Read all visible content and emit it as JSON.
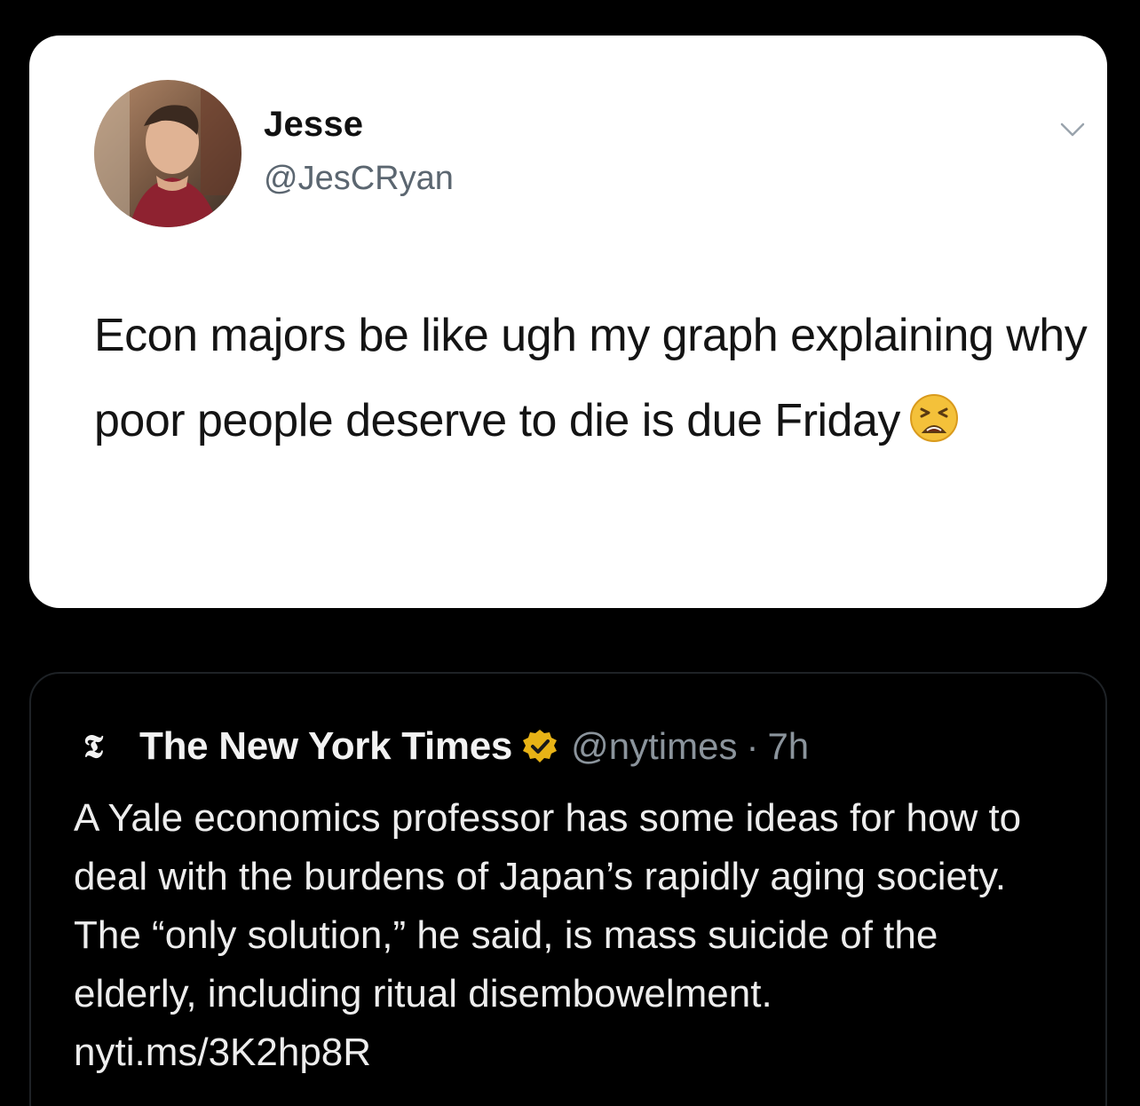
{
  "tweet": {
    "display_name": "Jesse",
    "handle": "@JesCRyan",
    "text": "Econ majors be like ugh my graph explaining why poor people deserve to die is due Friday",
    "emoji_icon": "tired-face-emoji",
    "menu_icon": "chevron-down-icon"
  },
  "quoted_tweet": {
    "logo_glyph": "𝕿",
    "display_name": "The New York Times",
    "verified_icon": "verified-badge-icon",
    "verified_color": "#e8b316",
    "handle": "@nytimes",
    "separator": "·",
    "time": "7h",
    "text": "A Yale economics professor has some ideas for how to deal with the burdens of Japan’s rapidly aging society. The “only solution,” he said, is mass suicide of the elderly, including ritual disembowelment. nyti.ms/3K2hp8R"
  },
  "colors": {
    "background": "#000000",
    "card_light": "#ffffff",
    "text_dark": "#141414",
    "text_muted": "#5b6670",
    "text_light": "#ededed",
    "quote_border": "#1e2226"
  }
}
